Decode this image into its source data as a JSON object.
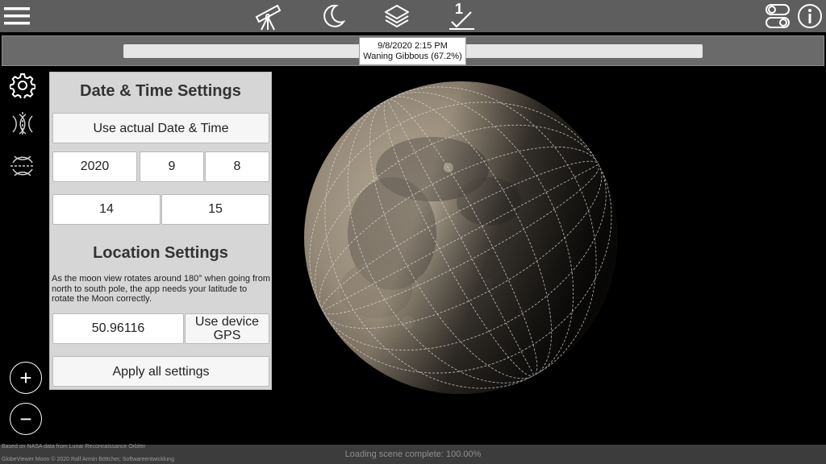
{
  "topbar": {
    "menu_icon": "hamburger-menu-icon",
    "telescope_icon": "telescope-icon",
    "moon_phase_icon": "crescent-moon-icon",
    "layers_icon": "layers-icon",
    "marker_icon": "marker-number-icon",
    "marker_number": "1",
    "toggle_icon": "toggle-switches-icon",
    "info_icon": "info-icon"
  },
  "timeline": {
    "tooltip_datetime": "9/8/2020 2:15 PM",
    "tooltip_phase": "Waning Gibbous (67.2%)"
  },
  "sidebar": {
    "settings_icon": "gear-icon",
    "mirror_horizontal_icon": "mirror-horizontal-icon",
    "mirror_vertical_icon": "mirror-vertical-icon",
    "zoom_in_label": "+",
    "zoom_out_label": "−"
  },
  "panel": {
    "datetime_title": "Date & Time Settings",
    "use_actual_label": "Use actual Date & Time",
    "year": "2020",
    "month": "9",
    "day": "8",
    "hour": "14",
    "minute": "15",
    "location_title": "Location Settings",
    "location_desc": "As the moon view rotates around 180° when going from north to south pole, the app needs your latitude to rotate the Moon correctly.",
    "latitude": "50.96116",
    "gps_label": "Use device GPS",
    "apply_label": "Apply all settings"
  },
  "footer": {
    "credit_line1": "Based on NASA data from Lunar Reconnaissance Orbiter",
    "credit_line2": "GlobeViewer Moon © 2020 Ralf Armin Böttcher, Softwareentwicklung",
    "status": "Loading scene complete: 100.00%"
  },
  "colors": {
    "topbar": "#5e5e5e",
    "panel": "#d6d6d6",
    "background": "#000000"
  }
}
